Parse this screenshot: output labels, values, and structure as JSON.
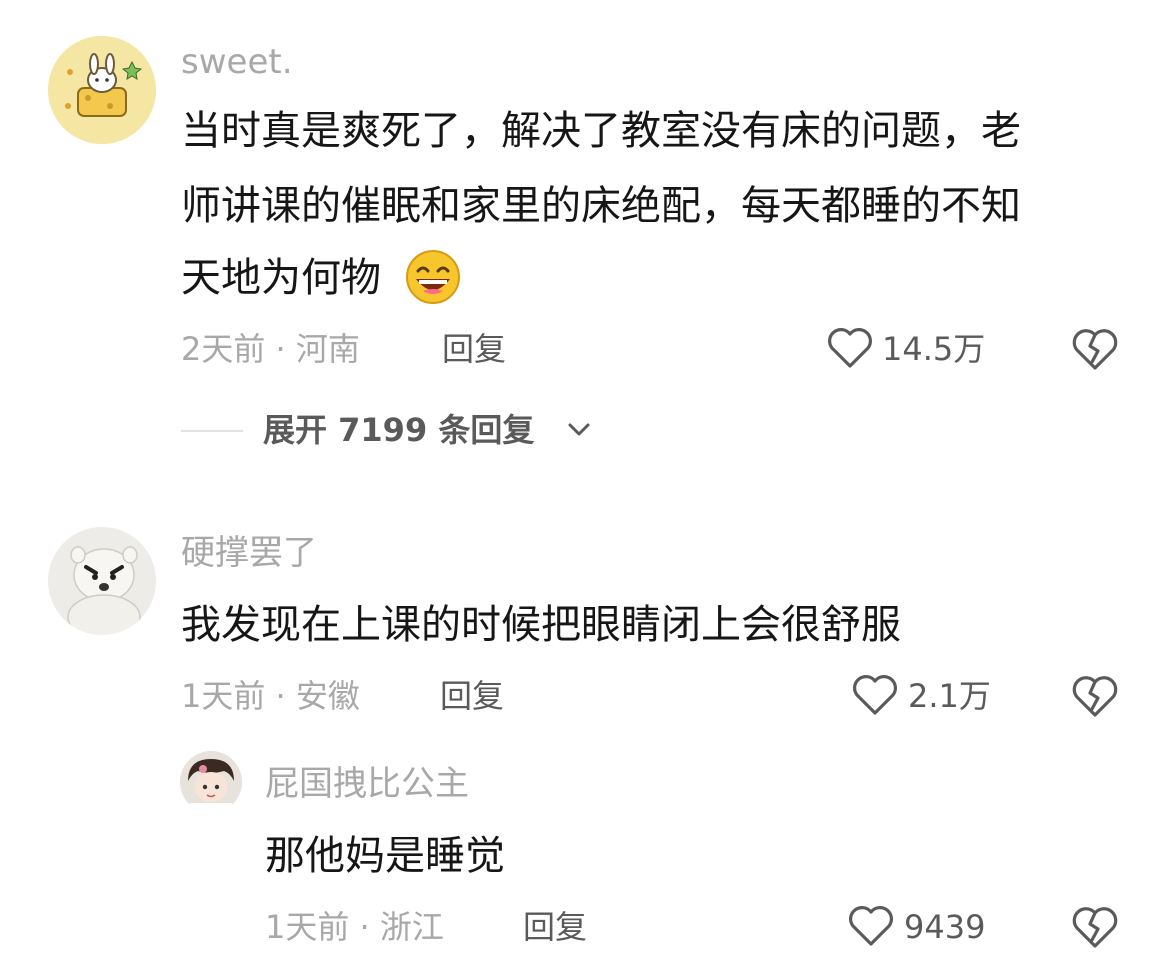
{
  "comments": [
    {
      "username": "sweet.",
      "lines": [
        "当时真是爽死了，解决了教室没有床的问题，老",
        "师讲课的催眠和家里的床绝配，每天都睡的不知",
        "天地为何物"
      ],
      "meta": "2天前 · 河南",
      "reply_label": "回复",
      "likes": "14.5万",
      "expand_label": "展开 7199 条回复"
    },
    {
      "username": "硬撑罢了",
      "lines": [
        "我发现在上课的时候把眼睛闭上会很舒服"
      ],
      "meta": "1天前 · 安徽",
      "reply_label": "回复",
      "likes": "2.1万"
    },
    {
      "username": "屁国拽比公主",
      "lines": [
        "那他妈是睡觉"
      ],
      "meta": "1天前 · 浙江",
      "reply_label": "回复",
      "likes": "9439"
    }
  ],
  "colors": {
    "text": "#161616",
    "muted": "#a8a8a8",
    "secondary": "#5a5a5a",
    "emoji": "#f5b800"
  },
  "icons": [
    "heart-icon",
    "broken-heart-icon",
    "chevron-down-icon",
    "grin-emoji-icon"
  ]
}
